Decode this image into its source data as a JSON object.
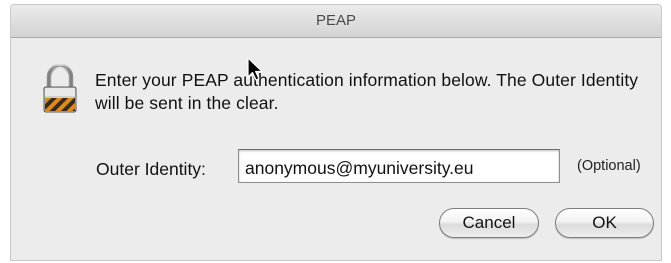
{
  "dialog": {
    "title": "PEAP",
    "message": "Enter your PEAP authentication information below. The Outer Identity will be sent in the clear.",
    "outer_identity_label": "Outer Identity:",
    "outer_identity_value": "anonymous@myuniversity.eu",
    "optional_note": "(Optional)",
    "cancel_label": "Cancel",
    "ok_label": "OK"
  },
  "icons": {
    "lock": "lock-icon",
    "cursor": "mouse-cursor-icon"
  },
  "colors": {
    "window_bg": "#ececec",
    "lock_shackle": "#b8b8b8",
    "lock_body_stripe_dark": "#3a2a1a",
    "lock_body_stripe_light": "#e08a1e"
  }
}
